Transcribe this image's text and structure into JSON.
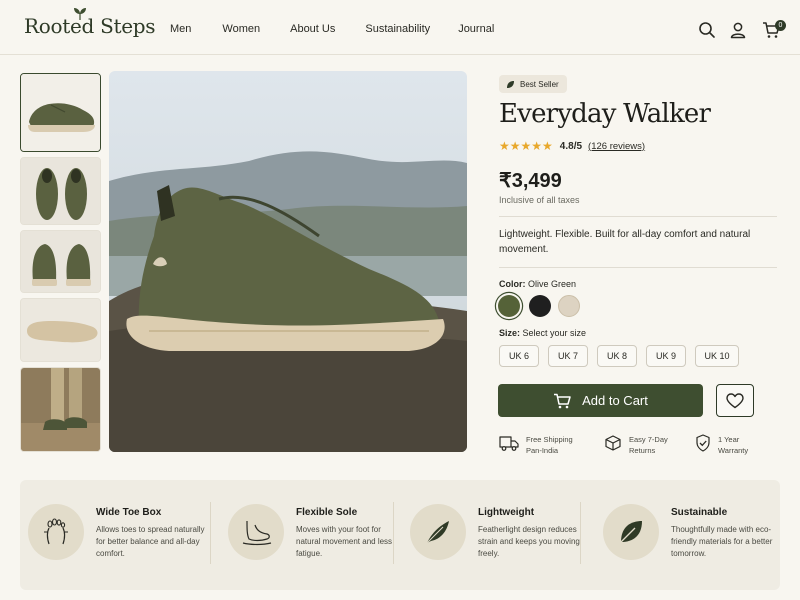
{
  "brand": {
    "name": "Rooted Steps"
  },
  "nav": {
    "items": [
      "Men",
      "Women",
      "About Us",
      "Sustainability",
      "Journal"
    ]
  },
  "header": {
    "cart_count": "0",
    "icons": [
      "search-icon",
      "user-icon",
      "cart-icon"
    ]
  },
  "product": {
    "badge": "Best Seller",
    "title": "Everyday Walker",
    "stars": "★★★★★",
    "rating": "4.8/5",
    "reviews": "(126 reviews)",
    "price": "₹3,499",
    "tax_note": "Inclusive of all taxes",
    "description": "Lightweight. Flexible. Built for all-day comfort and natural movement.",
    "color_label": "Color:",
    "color_value": "Olive Green",
    "colors": [
      "#556238",
      "#1f1f1f",
      "#ddd3c2"
    ],
    "size_label": "Size:",
    "size_value": "Select your size",
    "sizes": [
      "UK 6",
      "UK 7",
      "UK 8",
      "UK 9",
      "UK 10"
    ],
    "add_to_cart": "Add to Cart"
  },
  "perks": [
    {
      "line1": "Free Shipping",
      "line2": "Pan-India"
    },
    {
      "line1": "Easy 7-Day",
      "line2": "Returns"
    },
    {
      "line1": "1 Year",
      "line2": "Warranty"
    }
  ],
  "features": [
    {
      "title": "Wide Toe Box",
      "desc": "Allows toes to spread naturally for better balance and all-day comfort."
    },
    {
      "title": "Flexible Sole",
      "desc": "Moves with your foot for natural movement and less fatigue."
    },
    {
      "title": "Lightweight",
      "desc": "Featherlight design reduces strain and keeps you moving freely."
    },
    {
      "title": "Sustainable",
      "desc": "Thoughtfully made with eco-friendly materials for a better tomorrow."
    }
  ],
  "colors": {
    "accent": "#3e4e30",
    "star": "#e8a82c",
    "background": "#f8f6f0"
  }
}
